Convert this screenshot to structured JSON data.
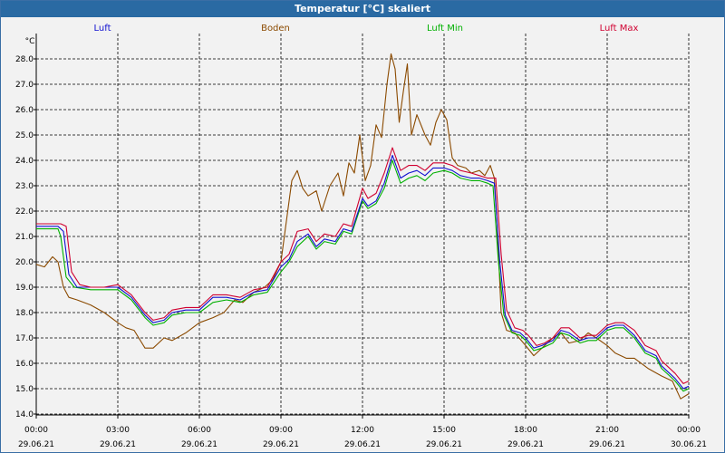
{
  "window": {
    "title": "Temperatur [°C] skaliert"
  },
  "chart_data": {
    "type": "line",
    "title": "Temperatur [°C] skaliert",
    "ylabel": "°C",
    "ylim": [
      14.0,
      28.5
    ],
    "xlim": [
      0,
      24
    ],
    "grid": true,
    "legend_placement": "top",
    "y_ticks": [
      "14.0",
      "15.0",
      "16.0",
      "17.0",
      "18.0",
      "19.0",
      "20.0",
      "21.0",
      "22.0",
      "23.0",
      "24.0",
      "25.0",
      "26.0",
      "27.0",
      "28.0"
    ],
    "x_ticks": [
      {
        "x": 0,
        "time": "00:00",
        "date": "29.06.21"
      },
      {
        "x": 3,
        "time": "03:00",
        "date": "29.06.21"
      },
      {
        "x": 6,
        "time": "06:00",
        "date": "29.06.21"
      },
      {
        "x": 9,
        "time": "09:00",
        "date": "29.06.21"
      },
      {
        "x": 12,
        "time": "12:00",
        "date": "29.06.21"
      },
      {
        "x": 15,
        "time": "15:00",
        "date": "29.06.21"
      },
      {
        "x": 18,
        "time": "18:00",
        "date": "29.06.21"
      },
      {
        "x": 21,
        "time": "21:00",
        "date": "29.06.21"
      },
      {
        "x": 24,
        "time": "00:00",
        "date": "30.06.21"
      }
    ],
    "series": [
      {
        "name": "Boden",
        "color": "#8b4a00",
        "points": [
          [
            0.0,
            19.9
          ],
          [
            0.3,
            19.8
          ],
          [
            0.6,
            20.2
          ],
          [
            0.8,
            20.0
          ],
          [
            1.0,
            19.0
          ],
          [
            1.2,
            18.6
          ],
          [
            1.5,
            18.5
          ],
          [
            2.0,
            18.3
          ],
          [
            2.5,
            18.0
          ],
          [
            3.0,
            17.6
          ],
          [
            3.3,
            17.4
          ],
          [
            3.6,
            17.3
          ],
          [
            4.0,
            16.6
          ],
          [
            4.3,
            16.6
          ],
          [
            4.7,
            17.0
          ],
          [
            5.0,
            16.9
          ],
          [
            5.5,
            17.2
          ],
          [
            6.0,
            17.6
          ],
          [
            6.5,
            17.8
          ],
          [
            6.9,
            18.0
          ],
          [
            7.3,
            18.5
          ],
          [
            7.6,
            18.4
          ],
          [
            8.0,
            18.8
          ],
          [
            8.4,
            19.0
          ],
          [
            8.7,
            19.3
          ],
          [
            9.0,
            20.0
          ],
          [
            9.2,
            21.6
          ],
          [
            9.4,
            23.2
          ],
          [
            9.6,
            23.6
          ],
          [
            9.8,
            22.9
          ],
          [
            10.0,
            22.6
          ],
          [
            10.3,
            22.8
          ],
          [
            10.5,
            22.0
          ],
          [
            10.8,
            23.0
          ],
          [
            11.1,
            23.5
          ],
          [
            11.3,
            22.6
          ],
          [
            11.5,
            23.9
          ],
          [
            11.7,
            23.5
          ],
          [
            11.9,
            25.0
          ],
          [
            12.1,
            23.2
          ],
          [
            12.3,
            23.8
          ],
          [
            12.5,
            25.4
          ],
          [
            12.7,
            24.9
          ],
          [
            12.9,
            27.0
          ],
          [
            13.05,
            28.2
          ],
          [
            13.2,
            27.6
          ],
          [
            13.35,
            25.5
          ],
          [
            13.5,
            26.7
          ],
          [
            13.65,
            27.8
          ],
          [
            13.8,
            25.0
          ],
          [
            14.0,
            25.8
          ],
          [
            14.3,
            25.0
          ],
          [
            14.5,
            24.6
          ],
          [
            14.7,
            25.5
          ],
          [
            14.9,
            26.0
          ],
          [
            15.1,
            25.6
          ],
          [
            15.3,
            24.1
          ],
          [
            15.5,
            23.8
          ],
          [
            15.8,
            23.7
          ],
          [
            16.0,
            23.5
          ],
          [
            16.3,
            23.6
          ],
          [
            16.5,
            23.4
          ],
          [
            16.7,
            23.8
          ],
          [
            16.85,
            23.3
          ],
          [
            16.95,
            21.5
          ],
          [
            17.1,
            18.0
          ],
          [
            17.3,
            17.3
          ],
          [
            17.6,
            17.2
          ],
          [
            18.0,
            16.7
          ],
          [
            18.3,
            16.3
          ],
          [
            18.6,
            16.6
          ],
          [
            19.0,
            17.0
          ],
          [
            19.3,
            17.2
          ],
          [
            19.6,
            16.8
          ],
          [
            20.0,
            16.9
          ],
          [
            20.3,
            17.2
          ],
          [
            20.6,
            17.0
          ],
          [
            21.0,
            16.7
          ],
          [
            21.3,
            16.4
          ],
          [
            21.7,
            16.2
          ],
          [
            22.0,
            16.2
          ],
          [
            22.5,
            15.8
          ],
          [
            23.0,
            15.5
          ],
          [
            23.4,
            15.3
          ],
          [
            23.7,
            14.6
          ],
          [
            24.0,
            14.8
          ]
        ]
      },
      {
        "name": "Luft Min",
        "color": "#00b000",
        "points": [
          [
            0.0,
            21.3
          ],
          [
            0.5,
            21.3
          ],
          [
            0.8,
            21.3
          ],
          [
            0.9,
            21.0
          ],
          [
            1.1,
            19.4
          ],
          [
            1.4,
            19.0
          ],
          [
            2.0,
            18.9
          ],
          [
            2.5,
            18.9
          ],
          [
            3.0,
            18.9
          ],
          [
            3.5,
            18.5
          ],
          [
            4.0,
            17.8
          ],
          [
            4.3,
            17.5
          ],
          [
            4.7,
            17.6
          ],
          [
            5.0,
            17.9
          ],
          [
            5.5,
            18.0
          ],
          [
            6.0,
            18.0
          ],
          [
            6.5,
            18.4
          ],
          [
            7.0,
            18.5
          ],
          [
            7.5,
            18.4
          ],
          [
            8.0,
            18.7
          ],
          [
            8.5,
            18.8
          ],
          [
            9.0,
            19.6
          ],
          [
            9.3,
            20.0
          ],
          [
            9.6,
            20.6
          ],
          [
            10.0,
            21.0
          ],
          [
            10.3,
            20.5
          ],
          [
            10.6,
            20.8
          ],
          [
            11.0,
            20.7
          ],
          [
            11.3,
            21.2
          ],
          [
            11.6,
            21.1
          ],
          [
            12.0,
            22.4
          ],
          [
            12.2,
            22.1
          ],
          [
            12.5,
            22.3
          ],
          [
            12.8,
            22.9
          ],
          [
            13.1,
            24.0
          ],
          [
            13.4,
            23.1
          ],
          [
            13.7,
            23.3
          ],
          [
            14.0,
            23.4
          ],
          [
            14.3,
            23.2
          ],
          [
            14.6,
            23.5
          ],
          [
            15.0,
            23.6
          ],
          [
            15.3,
            23.5
          ],
          [
            15.6,
            23.3
          ],
          [
            16.0,
            23.2
          ],
          [
            16.3,
            23.2
          ],
          [
            16.6,
            23.1
          ],
          [
            16.8,
            23.0
          ],
          [
            17.0,
            20.0
          ],
          [
            17.2,
            17.9
          ],
          [
            17.5,
            17.2
          ],
          [
            17.8,
            17.1
          ],
          [
            18.0,
            16.9
          ],
          [
            18.3,
            16.5
          ],
          [
            18.6,
            16.6
          ],
          [
            19.0,
            16.8
          ],
          [
            19.3,
            17.2
          ],
          [
            19.6,
            17.1
          ],
          [
            20.0,
            16.8
          ],
          [
            20.3,
            16.9
          ],
          [
            20.6,
            16.9
          ],
          [
            21.0,
            17.3
          ],
          [
            21.3,
            17.4
          ],
          [
            21.6,
            17.4
          ],
          [
            22.0,
            17.0
          ],
          [
            22.4,
            16.4
          ],
          [
            22.8,
            16.2
          ],
          [
            23.0,
            15.8
          ],
          [
            23.5,
            15.3
          ],
          [
            23.8,
            14.9
          ],
          [
            24.0,
            15.0
          ]
        ]
      },
      {
        "name": "Luft",
        "color": "#1010d0",
        "points": [
          [
            0.0,
            21.4
          ],
          [
            0.5,
            21.4
          ],
          [
            0.8,
            21.4
          ],
          [
            1.0,
            21.2
          ],
          [
            1.2,
            19.5
          ],
          [
            1.5,
            19.0
          ],
          [
            2.0,
            19.0
          ],
          [
            2.5,
            19.0
          ],
          [
            3.0,
            19.0
          ],
          [
            3.5,
            18.6
          ],
          [
            4.0,
            17.9
          ],
          [
            4.3,
            17.6
          ],
          [
            4.7,
            17.7
          ],
          [
            5.0,
            18.0
          ],
          [
            5.5,
            18.1
          ],
          [
            6.0,
            18.1
          ],
          [
            6.5,
            18.6
          ],
          [
            7.0,
            18.6
          ],
          [
            7.5,
            18.5
          ],
          [
            8.0,
            18.8
          ],
          [
            8.5,
            18.9
          ],
          [
            9.0,
            19.8
          ],
          [
            9.3,
            20.1
          ],
          [
            9.6,
            20.8
          ],
          [
            10.0,
            21.1
          ],
          [
            10.3,
            20.6
          ],
          [
            10.6,
            20.9
          ],
          [
            11.0,
            20.8
          ],
          [
            11.3,
            21.3
          ],
          [
            11.6,
            21.2
          ],
          [
            12.0,
            22.5
          ],
          [
            12.2,
            22.2
          ],
          [
            12.5,
            22.4
          ],
          [
            12.8,
            23.1
          ],
          [
            13.1,
            24.2
          ],
          [
            13.4,
            23.3
          ],
          [
            13.7,
            23.5
          ],
          [
            14.0,
            23.6
          ],
          [
            14.3,
            23.4
          ],
          [
            14.6,
            23.7
          ],
          [
            15.0,
            23.7
          ],
          [
            15.3,
            23.6
          ],
          [
            15.6,
            23.4
          ],
          [
            16.0,
            23.3
          ],
          [
            16.3,
            23.3
          ],
          [
            16.6,
            23.2
          ],
          [
            16.85,
            23.1
          ],
          [
            17.05,
            20.0
          ],
          [
            17.25,
            17.9
          ],
          [
            17.5,
            17.3
          ],
          [
            17.8,
            17.2
          ],
          [
            18.0,
            17.0
          ],
          [
            18.3,
            16.6
          ],
          [
            18.6,
            16.7
          ],
          [
            19.0,
            16.9
          ],
          [
            19.3,
            17.3
          ],
          [
            19.6,
            17.2
          ],
          [
            20.0,
            16.9
          ],
          [
            20.3,
            17.0
          ],
          [
            20.6,
            17.0
          ],
          [
            21.0,
            17.4
          ],
          [
            21.3,
            17.5
          ],
          [
            21.6,
            17.5
          ],
          [
            22.0,
            17.1
          ],
          [
            22.4,
            16.5
          ],
          [
            22.8,
            16.3
          ],
          [
            23.0,
            15.9
          ],
          [
            23.5,
            15.4
          ],
          [
            23.8,
            15.0
          ],
          [
            24.0,
            15.1
          ]
        ]
      },
      {
        "name": "Luft Max",
        "color": "#d00030",
        "points": [
          [
            0.0,
            21.5
          ],
          [
            0.5,
            21.5
          ],
          [
            0.9,
            21.5
          ],
          [
            1.1,
            21.4
          ],
          [
            1.3,
            19.6
          ],
          [
            1.6,
            19.1
          ],
          [
            2.0,
            19.0
          ],
          [
            2.5,
            19.0
          ],
          [
            3.0,
            19.1
          ],
          [
            3.5,
            18.7
          ],
          [
            4.0,
            18.0
          ],
          [
            4.3,
            17.7
          ],
          [
            4.7,
            17.8
          ],
          [
            5.0,
            18.1
          ],
          [
            5.5,
            18.2
          ],
          [
            6.0,
            18.2
          ],
          [
            6.5,
            18.7
          ],
          [
            7.0,
            18.7
          ],
          [
            7.5,
            18.6
          ],
          [
            8.0,
            18.9
          ],
          [
            8.5,
            19.0
          ],
          [
            9.0,
            20.0
          ],
          [
            9.3,
            20.3
          ],
          [
            9.6,
            21.2
          ],
          [
            10.0,
            21.3
          ],
          [
            10.3,
            20.8
          ],
          [
            10.6,
            21.1
          ],
          [
            11.0,
            21.0
          ],
          [
            11.3,
            21.5
          ],
          [
            11.6,
            21.4
          ],
          [
            12.0,
            22.9
          ],
          [
            12.2,
            22.5
          ],
          [
            12.5,
            22.7
          ],
          [
            12.8,
            23.5
          ],
          [
            13.1,
            24.5
          ],
          [
            13.4,
            23.6
          ],
          [
            13.7,
            23.8
          ],
          [
            14.0,
            23.8
          ],
          [
            14.3,
            23.6
          ],
          [
            14.6,
            23.9
          ],
          [
            15.0,
            23.9
          ],
          [
            15.3,
            23.8
          ],
          [
            15.6,
            23.6
          ],
          [
            16.0,
            23.5
          ],
          [
            16.3,
            23.4
          ],
          [
            16.6,
            23.3
          ],
          [
            16.9,
            23.3
          ],
          [
            17.1,
            20.3
          ],
          [
            17.3,
            18.1
          ],
          [
            17.6,
            17.4
          ],
          [
            17.9,
            17.3
          ],
          [
            18.1,
            17.1
          ],
          [
            18.4,
            16.7
          ],
          [
            18.7,
            16.8
          ],
          [
            19.0,
            17.0
          ],
          [
            19.3,
            17.4
          ],
          [
            19.6,
            17.4
          ],
          [
            20.0,
            17.0
          ],
          [
            20.3,
            17.1
          ],
          [
            20.6,
            17.1
          ],
          [
            21.0,
            17.5
          ],
          [
            21.3,
            17.6
          ],
          [
            21.6,
            17.6
          ],
          [
            22.0,
            17.3
          ],
          [
            22.4,
            16.7
          ],
          [
            22.8,
            16.5
          ],
          [
            23.0,
            16.1
          ],
          [
            23.5,
            15.6
          ],
          [
            23.8,
            15.2
          ],
          [
            24.0,
            15.3
          ]
        ]
      }
    ],
    "legend": [
      {
        "name": "Luft",
        "color": "#1010d0"
      },
      {
        "name": "Boden",
        "color": "#8b4a00"
      },
      {
        "name": "Luft Min",
        "color": "#00b000"
      },
      {
        "name": "Luft Max",
        "color": "#d00030"
      }
    ]
  }
}
